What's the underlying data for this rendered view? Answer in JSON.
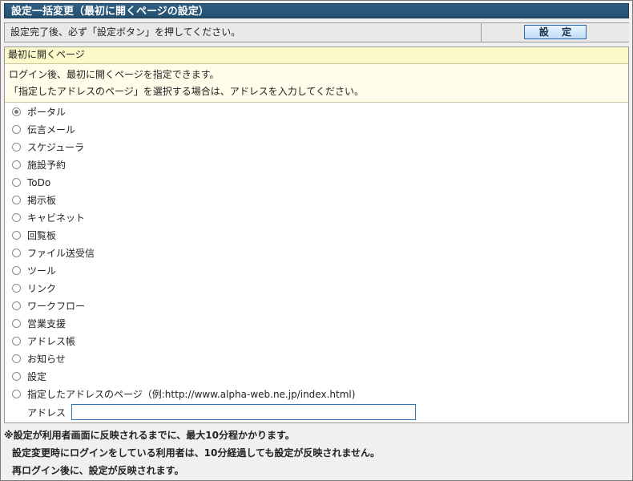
{
  "header": {
    "title": "設定一括変更（最初に開くページの設定）"
  },
  "notice": {
    "text": "設定完了後、必ず「設定ボタン」を押してください。",
    "button_label": "設 定"
  },
  "section": {
    "title": "最初に開くページ",
    "description": [
      "ログイン後、最初に開くページを指定できます。",
      "「指定したアドレスのページ」を選択する場合は、アドレスを入力してください。"
    ],
    "options": [
      {
        "label": "ポータル",
        "checked": true
      },
      {
        "label": "伝言メール",
        "checked": false
      },
      {
        "label": "スケジューラ",
        "checked": false
      },
      {
        "label": "施設予約",
        "checked": false
      },
      {
        "label": "ToDo",
        "checked": false
      },
      {
        "label": "掲示板",
        "checked": false
      },
      {
        "label": "キャビネット",
        "checked": false
      },
      {
        "label": "回覧板",
        "checked": false
      },
      {
        "label": "ファイル送受信",
        "checked": false
      },
      {
        "label": "ツール",
        "checked": false
      },
      {
        "label": "リンク",
        "checked": false
      },
      {
        "label": "ワークフロー",
        "checked": false
      },
      {
        "label": "営業支援",
        "checked": false
      },
      {
        "label": "アドレス帳",
        "checked": false
      },
      {
        "label": "お知らせ",
        "checked": false
      },
      {
        "label": "設定",
        "checked": false
      },
      {
        "label": "指定したアドレスのページ（例:http://www.alpha-web.ne.jp/index.html)",
        "checked": false
      }
    ],
    "address": {
      "label": "アドレス",
      "value": ""
    }
  },
  "footer": {
    "lines": [
      "※設定が利用者画面に反映されるまでに、最大10分程かかります。",
      "設定変更時にログインをしている利用者は、10分経過しても設定が反映されません。",
      "再ログイン後に、設定が反映されます。"
    ]
  },
  "colors": {
    "title_bar": "#2f5f86",
    "section_header": "#fbf8c9",
    "input_border": "#2e6fbe"
  }
}
